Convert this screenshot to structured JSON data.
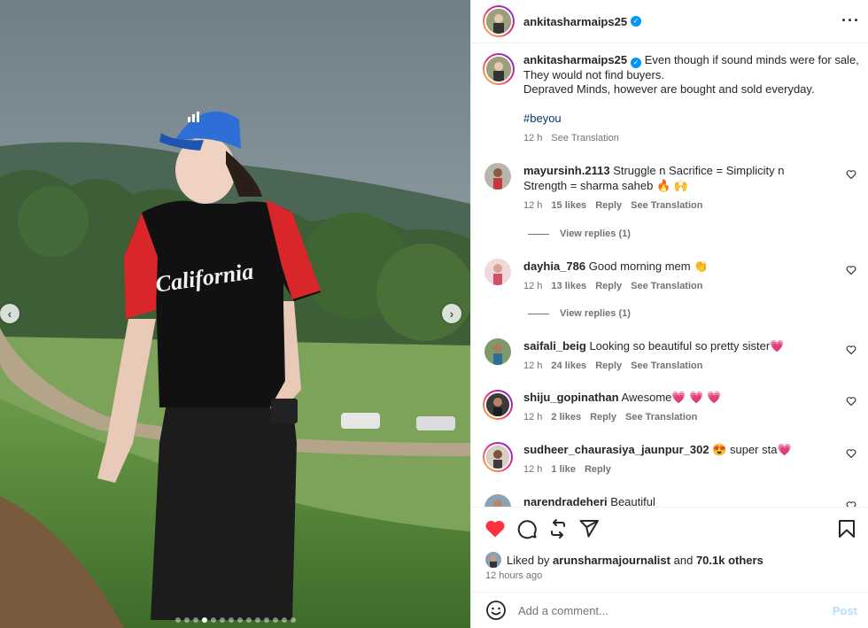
{
  "post": {
    "username": "ankitasharmaips25",
    "verified": true
  },
  "caption": {
    "username": "ankitasharmaips25",
    "line1": "Even though if sound minds were for sale,",
    "line2": "They would not find buyers.",
    "line3": "Depraved Minds, however are bought and sold everyday.",
    "hashtag": "#beyou",
    "time": "12 h",
    "translate": "See Translation"
  },
  "comments": [
    {
      "username": "mayursinh.2113",
      "text": "Struggle n Sacrifice = Simplicity n Strength = sharma saheb 🔥 🙌",
      "time": "12 h",
      "likes": "15 likes",
      "reply": "Reply",
      "translate": "See Translation",
      "view_replies": "View replies (1)"
    },
    {
      "username": "dayhia_786",
      "text": "Good morning mem 👏",
      "time": "12 h",
      "likes": "13 likes",
      "reply": "Reply",
      "translate": "See Translation",
      "view_replies": "View replies (1)"
    },
    {
      "username": "saifali_beig",
      "text": "Looking so beautiful so pretty sister💗",
      "time": "12 h",
      "likes": "24 likes",
      "reply": "Reply",
      "translate": "See Translation"
    },
    {
      "username": "shiju_gopinathan",
      "text": "Awesome💗 💗 💗",
      "time": "12 h",
      "likes": "2 likes",
      "reply": "Reply",
      "translate": "See Translation"
    },
    {
      "username": "sudheer_chaurasiya_jaunpur_302",
      "text": "😍 super sta💗",
      "time": "12 h",
      "likes": "1 like",
      "reply": "Reply"
    },
    {
      "username": "narendradeheri",
      "text": "Beautiful"
    }
  ],
  "likes": {
    "prefix": "Liked by",
    "user": "arunsharmajournalist",
    "and": "and",
    "others": "70.1k others",
    "time": "12 hours ago"
  },
  "composer": {
    "placeholder": "Add a comment...",
    "post_label": "Post"
  },
  "carousel": {
    "slide_count": 14,
    "active_index": 3
  },
  "colors": {
    "like_red": "#ff3040",
    "link_blue": "#00376b",
    "verified_blue": "#0095f6",
    "post_disabled": "#b2dffc"
  },
  "icons": [
    "more-icon",
    "heart-icon",
    "comment-icon",
    "share-icon",
    "send-icon",
    "bookmark-icon",
    "emoji-icon",
    "chevron-left-icon",
    "chevron-right-icon",
    "verified-icon"
  ]
}
